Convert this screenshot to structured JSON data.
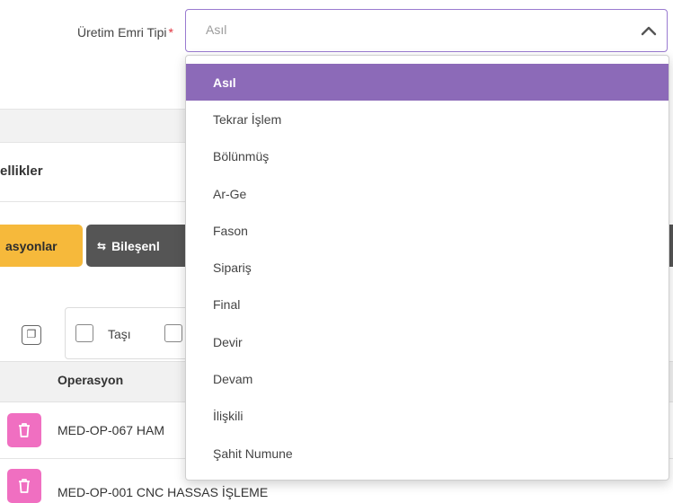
{
  "form": {
    "label": "Üretim Emri Tipi",
    "required_mark": "*",
    "select": {
      "value": "Asıl",
      "icon": "chevron-up-icon",
      "options": [
        "Asıl",
        "Tekrar İşlem",
        "Bölünmüş",
        "Ar-Ge",
        "Fason",
        "Sipariş",
        "Final",
        "Devir",
        "Devam",
        "İlişkili",
        "Şahit Numune"
      ],
      "selected_index": 0
    }
  },
  "section": {
    "title_fragment": "ellikler"
  },
  "buttons": {
    "operations_fragment": "asyonlar",
    "components_fragment": "Bileşenl"
  },
  "toolbar": {
    "move_label": "Taşı"
  },
  "table": {
    "column_operation": "Operasyon",
    "rows": [
      {
        "operation": "MED-OP-067 HAM"
      },
      {
        "operation": "MED-OP-001 CNC HASSAS İŞLEME"
      }
    ]
  },
  "colors": {
    "accent_purple": "#8c6ab8",
    "warning_yellow": "#f6b93b",
    "delete_pink": "#f06fc1",
    "dark_button": "#555555",
    "required_red": "#e0323e"
  }
}
